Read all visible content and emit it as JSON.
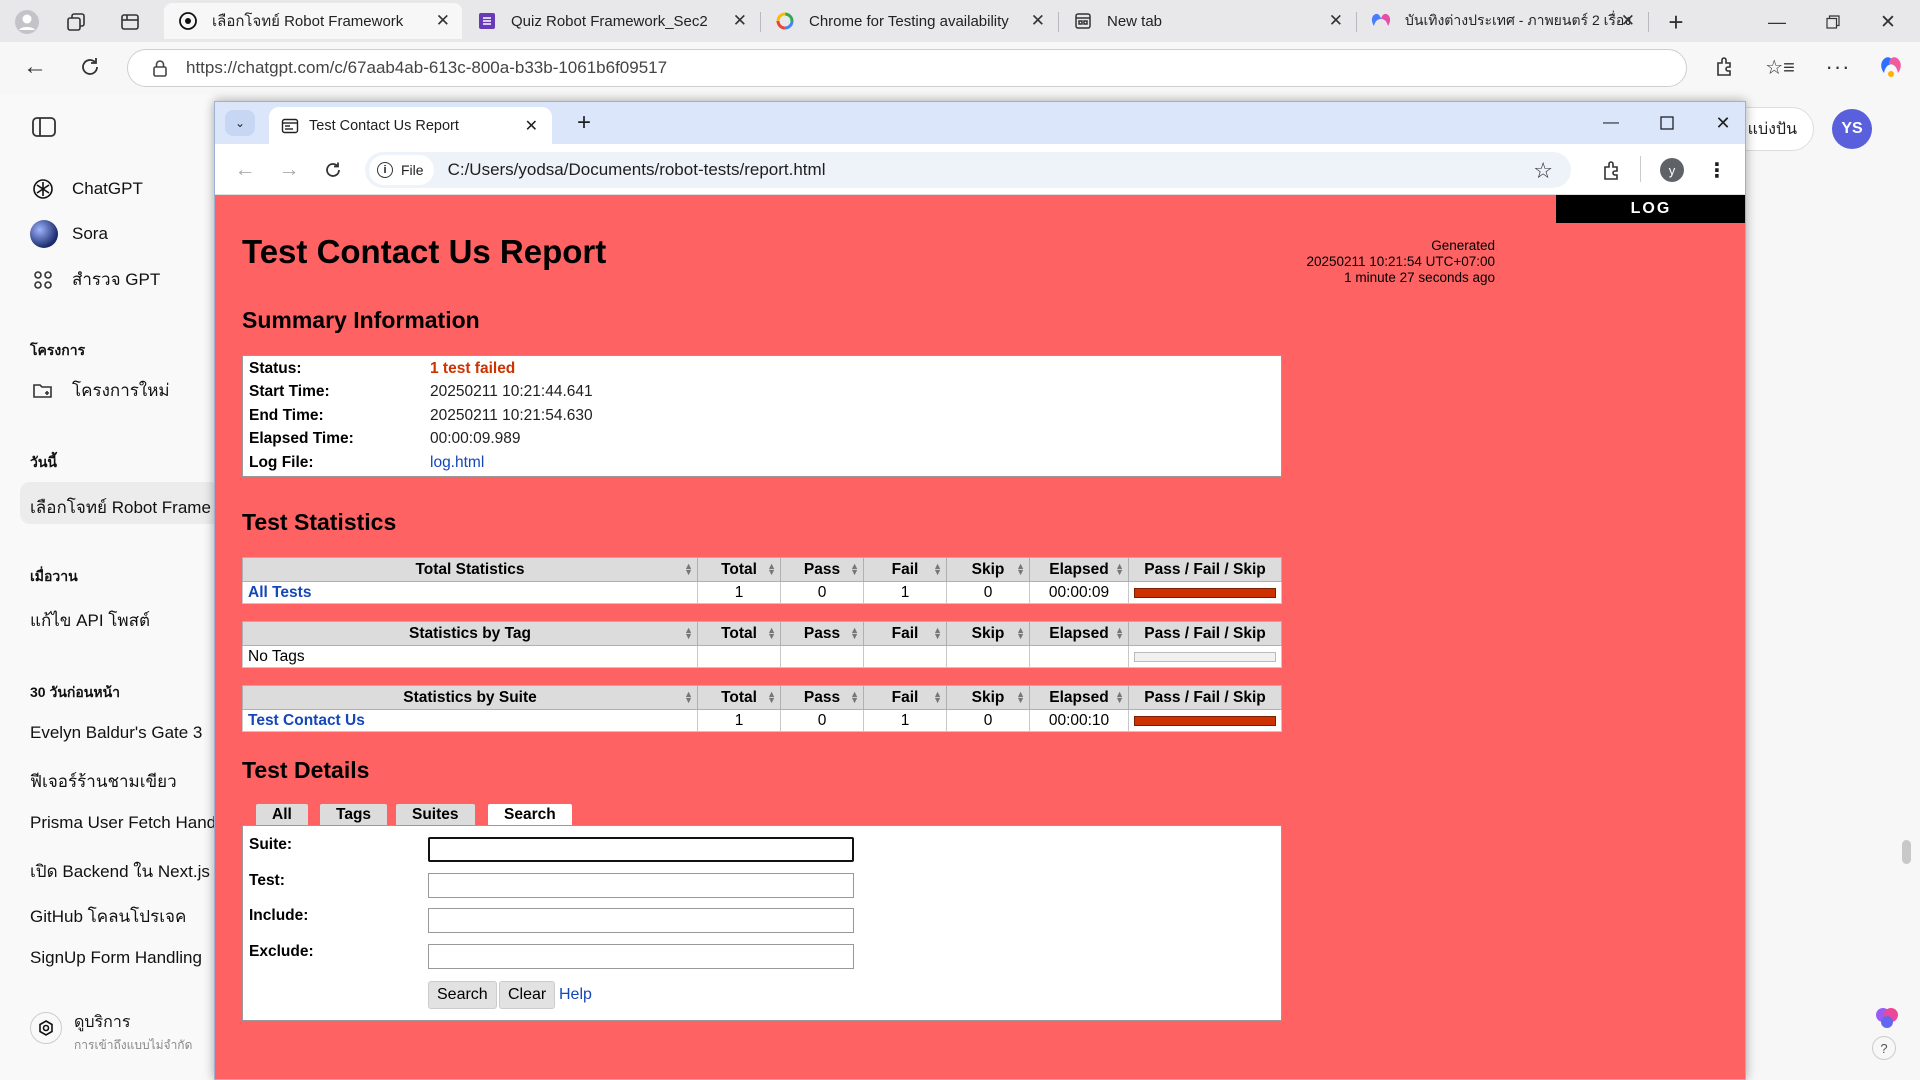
{
  "edge": {
    "tabs": [
      {
        "label": "เลือกโจทย์ Robot Framework",
        "icon": "chatgpt-icon",
        "active": true
      },
      {
        "label": "Quiz Robot Framework_Sec2",
        "icon": "forms-icon"
      },
      {
        "label": "Chrome for Testing availability",
        "icon": "google-icon"
      },
      {
        "label": "New tab",
        "icon": "newtab-icon"
      },
      {
        "label": "บันเทิงต่างประเทศ - ภาพยนตร์ 2 เรื่อง",
        "icon": "copilot-icon"
      }
    ],
    "url": "https://chatgpt.com/c/67aab4ab-613c-800a-b33b-1061b6f09517"
  },
  "chatgpt": {
    "nav": [
      {
        "label": "ChatGPT",
        "icon": "chatgpt-logo-icon"
      },
      {
        "label": "Sora",
        "icon": "sora-icon"
      },
      {
        "label": "สำรวจ GPT",
        "icon": "grid-icon"
      }
    ],
    "projects_header": "โครงการ",
    "new_project": "โครงการใหม่",
    "today_header": "วันนี้",
    "today_items": [
      "เลือกโจทย์ Robot Frame"
    ],
    "yesterday_header": "เมื่อวาน",
    "yesterday_items": [
      "แก้ไข API โพสต์"
    ],
    "last30_header": "30 วันก่อนหน้า",
    "last30_items": [
      "Evelyn Baldur's Gate 3",
      "ฟีเจอร์ร้านชามเขียว",
      "Prisma User Fetch Hand",
      "เปิด Backend ใน Next.js",
      "GitHub โคลนโปรเจค",
      "SignUp Form Handling"
    ],
    "upgrade_title": "ดูบริการ",
    "upgrade_sub": "การเข้าถึงแบบไม่จำกัด",
    "share_label": "แบ่งปัน",
    "avatar": "YS"
  },
  "chrome": {
    "tab_title": "Test Contact Us Report",
    "omnibox_chip": "File",
    "omnibox_url": "C:/Users/yodsa/Documents/robot-tests/report.html",
    "profile_initial": "y"
  },
  "report": {
    "log_link": "LOG",
    "title": "Test Contact Us Report",
    "generated_label": "Generated",
    "generated_time": "20250211 10:21:54 UTC+07:00",
    "generated_ago": "1 minute 27 seconds ago",
    "summary_title": "Summary Information",
    "summary": {
      "status_label": "Status:",
      "status_value": "1 test failed",
      "start_label": "Start Time:",
      "start_value": "20250211 10:21:44.641",
      "end_label": "End Time:",
      "end_value": "20250211 10:21:54.630",
      "elapsed_label": "Elapsed Time:",
      "elapsed_value": "00:00:09.989",
      "logfile_label": "Log File:",
      "logfile_value": "log.html"
    },
    "stats_title": "Test Statistics",
    "columns": [
      "Total",
      "Pass",
      "Fail",
      "Skip",
      "Elapsed",
      "Pass / Fail / Skip"
    ],
    "total_stats": {
      "header": "Total Statistics",
      "rows": [
        {
          "name": "All Tests",
          "total": "1",
          "pass": "0",
          "fail": "1",
          "skip": "0",
          "elapsed": "00:00:09"
        }
      ]
    },
    "tag_stats": {
      "header": "Statistics by Tag",
      "rows": [
        {
          "name": "No Tags"
        }
      ]
    },
    "suite_stats": {
      "header": "Statistics by Suite",
      "rows": [
        {
          "name": "Test Contact Us",
          "total": "1",
          "pass": "0",
          "fail": "1",
          "skip": "0",
          "elapsed": "00:00:10"
        }
      ]
    },
    "details_title": "Test Details",
    "detail_tabs": [
      "All",
      "Tags",
      "Suites",
      "Search"
    ],
    "search_form": {
      "suite_label": "Suite:",
      "test_label": "Test:",
      "include_label": "Include:",
      "exclude_label": "Exclude:",
      "search_button": "Search",
      "clear_button": "Clear",
      "help_link": "Help"
    },
    "colors": {
      "background": "#ff6262",
      "fail_bar": "#cc3300",
      "link": "#1447b8",
      "status_fail_text": "#cc3300"
    }
  }
}
